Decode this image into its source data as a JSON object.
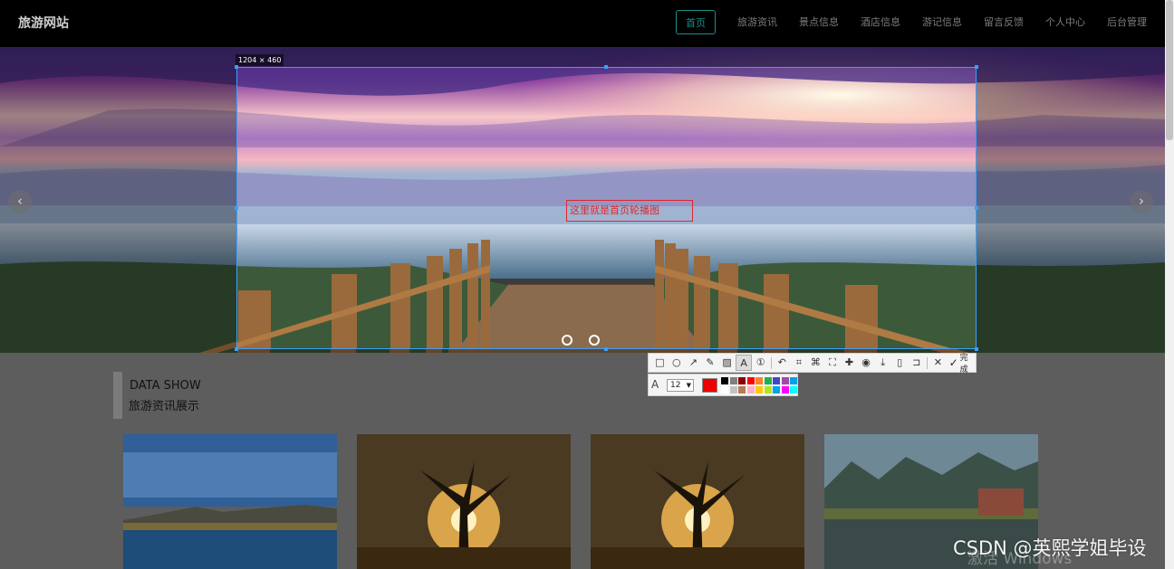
{
  "site": {
    "brand": "旅游网站"
  },
  "nav": {
    "active": "首页",
    "items": [
      "旅游资讯",
      "景点信息",
      "酒店信息",
      "游记信息",
      "留言反馈",
      "个人中心",
      "后台管理"
    ]
  },
  "carousel": {
    "prev_icon": "chevron-left-icon",
    "next_icon": "chevron-right-icon",
    "slide_count": 2
  },
  "capture": {
    "size_label": "1204 × 460",
    "annotation_text": "这里就是首页轮播图",
    "toolbar": {
      "tools": [
        "rectangle-icon",
        "ellipse-icon",
        "arrow-icon",
        "pencil-icon",
        "mosaic-icon",
        "text-icon",
        "serial-number-icon",
        "undo-icon",
        "ocr-icon",
        "translate-icon",
        "scroll-capture-icon",
        "pin-icon",
        "record-icon",
        "save-icon",
        "copy-icon",
        "bookmark-icon",
        "close-icon"
      ],
      "active_tool": "text-icon",
      "done_label": "完成"
    },
    "font_size": "12",
    "current_color": "#ee0000",
    "palette": [
      "#000000",
      "#7f7f7f",
      "#880000",
      "#ff0000",
      "#ff7f27",
      "#22b14c",
      "#3f48cc",
      "#a349a4",
      "#00a2e8",
      "#ffffff",
      "#c3c3c3",
      "#b97a57",
      "#ffaec9",
      "#ffc90e",
      "#b5e61d",
      "#00a2e8",
      "#ff00ff",
      "#00ffff"
    ]
  },
  "section": {
    "title_en": "DATA SHOW",
    "title_cn": "旅游资讯展示"
  },
  "watermarks": {
    "csdn": "CSDN @英熙学姐毕设",
    "windows": "激活 Windows"
  }
}
